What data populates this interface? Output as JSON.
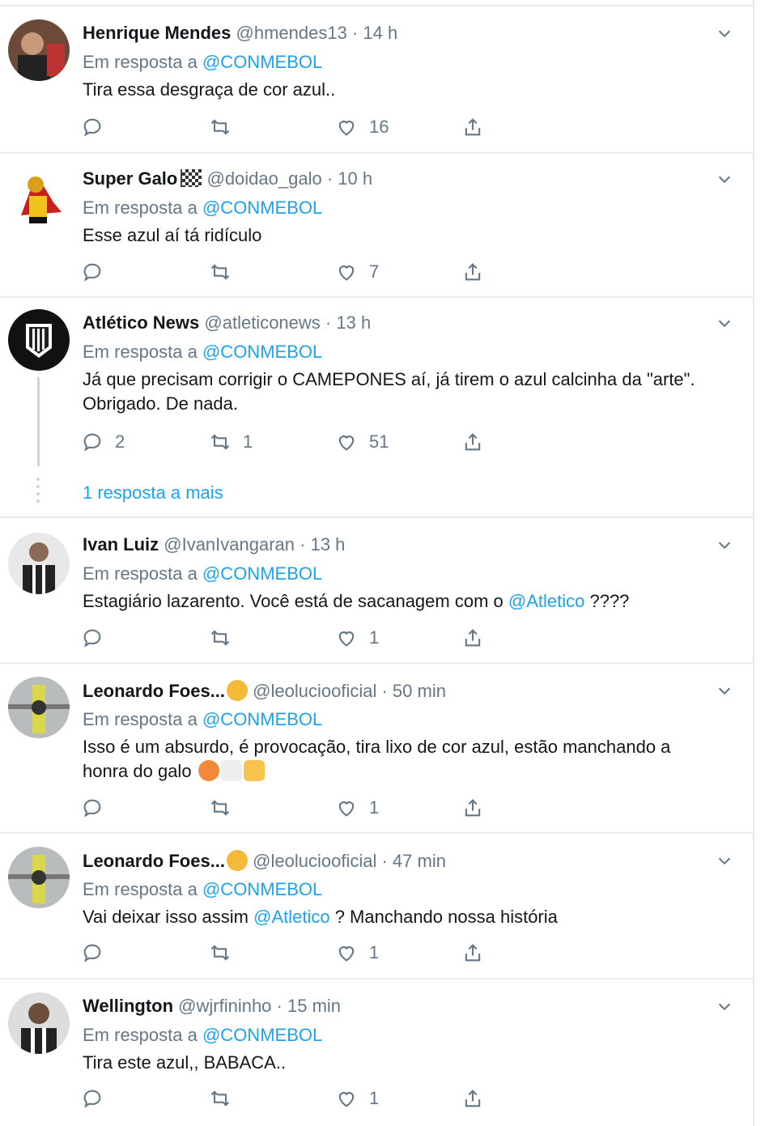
{
  "colors": {
    "accent": "#1da1f2",
    "muted": "#657786",
    "text": "#14171a",
    "border": "#e6ecf0"
  },
  "reply_prefix": "Em resposta a",
  "tweets": [
    {
      "name": "Henrique Mendes",
      "handle": "@hmendes13",
      "time": "· 14 h",
      "reply_to": "@CONMEBOL",
      "text": "Tira essa desgraça de cor azul..",
      "replies": "",
      "retweets": "",
      "likes": "16"
    },
    {
      "name": "Super Galo",
      "handle": "@doidao_galo",
      "time": "· 10 h",
      "reply_to": "@CONMEBOL",
      "text": "Esse azul aí tá ridículo",
      "replies": "",
      "retweets": "",
      "likes": "7"
    },
    {
      "name": "Atlético News",
      "handle": "@atleticonews",
      "time": "· 13 h",
      "reply_to": "@CONMEBOL",
      "text_line1": "Já que precisam corrigir o CAMEPONES aí, já tirem o azul calcinha da \"arte\".",
      "text_line2": "Obrigado. De nada.",
      "replies": "2",
      "retweets": "1",
      "likes": "51",
      "more_replies": "1 resposta a mais"
    },
    {
      "name": "Ivan Luiz",
      "handle": "@IvanIvangaran",
      "time": "· 13 h",
      "reply_to": "@CONMEBOL",
      "text_before": "Estagiário lazarento. Você está de sacanagem com o ",
      "text_mention": "@Atletico",
      "text_after": " ????",
      "replies": "",
      "retweets": "",
      "likes": "1"
    },
    {
      "name": "Leonardo Foes...",
      "handle": "@leoluciooficial",
      "time": "· 50 min",
      "reply_to": "@CONMEBOL",
      "text_line1": "Isso é um absurdo, é provocação, tira lixo de cor azul, estão manchando a",
      "text_line2": "honra do galo",
      "replies": "",
      "retweets": "",
      "likes": "1"
    },
    {
      "name": "Leonardo Foes...",
      "handle": "@leoluciooficial",
      "time": "· 47 min",
      "reply_to": "@CONMEBOL",
      "text_before": "Vai deixar isso assim ",
      "text_mention": "@Atletico",
      "text_after": " ? Manchando nossa história",
      "replies": "",
      "retweets": "",
      "likes": "1"
    },
    {
      "name": "Wellington",
      "handle": "@wjrfininho",
      "time": "· 15 min",
      "reply_to": "@CONMEBOL",
      "text": "Tira este azul,, BABACA..",
      "replies": "",
      "retweets": "",
      "likes": "1"
    }
  ]
}
